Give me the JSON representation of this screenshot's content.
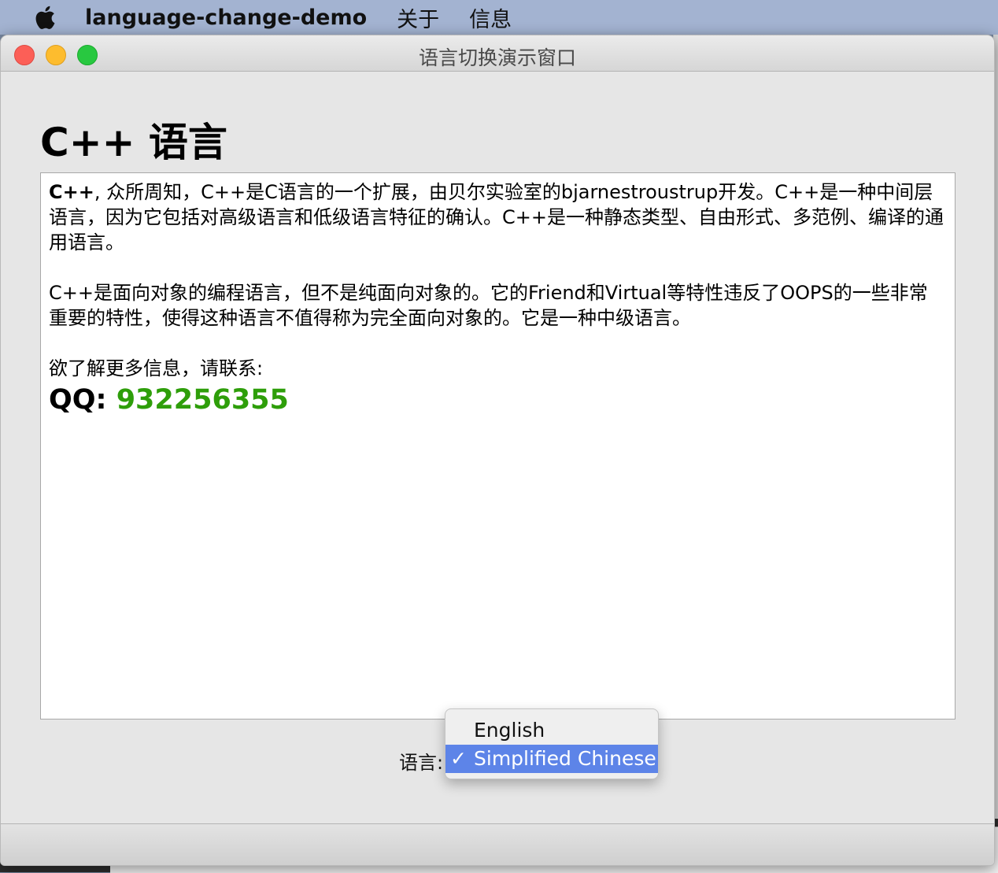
{
  "menubar": {
    "app_name": "language-change-demo",
    "items": [
      "关于",
      "信息"
    ]
  },
  "window": {
    "title": "语言切换演示窗口"
  },
  "page": {
    "heading": "C++ 语言",
    "p1_bold": "C++",
    "p1_rest": ", 众所周知，C++是C语言的一个扩展，由贝尔实验室的bjarnestroustrup开发。C++是一种中间层语言，因为它包括对高级语言和低级语言特征的确认。C++是一种静态类型、自由形式、多范例、编译的通用语言。",
    "p2": " C++是面向对象的编程语言，但不是纯面向对象的。它的Friend和Virtual等特性违反了OOPS的一些非常重要的特性，使得这种语言不值得称为完全面向对象的。它是一种中级语言。",
    "p3": "欲了解更多信息，请联系:",
    "qq_label": "QQ:",
    "qq_number": "932256355",
    "qq_color": "#2e9e0a"
  },
  "language": {
    "label": "语言:",
    "options": [
      "English",
      "Simplified Chinese"
    ],
    "selected": "Simplified Chinese",
    "check_mark": "✓",
    "highlight_color": "#5d84e8"
  }
}
